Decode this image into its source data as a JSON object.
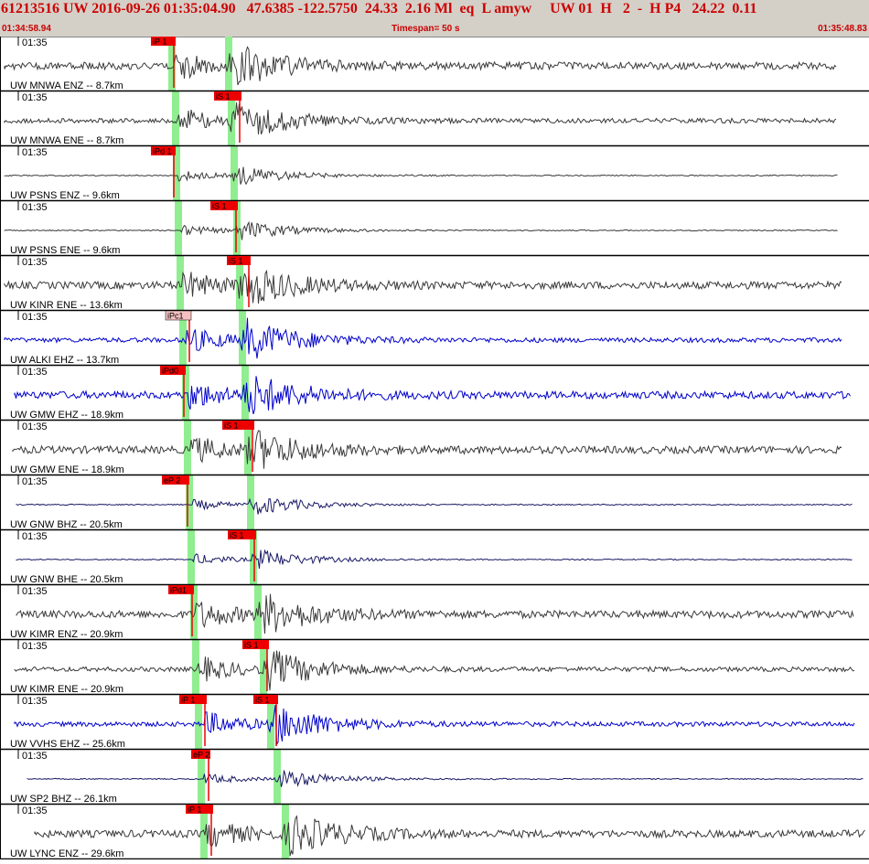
{
  "header": {
    "title": "61213516 UW 2016-09-26 01:35:04.90   47.6385 -122.5750  24.33  2.16 Ml  eq  L amyw     UW 01  H   2  -  H P4   24.22  0.11",
    "start_time": "01:34:58.94",
    "timespan": "Timespan=  50 s",
    "end_time": "01:35:48.83"
  },
  "colors": {
    "background": "#ffffff",
    "header_bg": "#d4d0c8",
    "header_text": "#cc0000",
    "trace_gray": "#3a3a3a",
    "trace_blue": "#0000cc",
    "trace_navy": "#1a1a66",
    "pick_flag": "#ee0000",
    "pick_flag_alt": "#f4c0c0",
    "phase_band": "#90ee90"
  },
  "panels": [
    {
      "station": "UW MNWA ENZ -- 8.7km",
      "time": "01:35",
      "pick": "iP 1",
      "color": "gray",
      "amp": "high",
      "alt": false
    },
    {
      "station": "UW MNWA ENE -- 8.7km",
      "time": "01:35",
      "pick": "iS 1",
      "color": "gray",
      "amp": "med",
      "alt": false
    },
    {
      "station": "UW PSNS ENZ -- 9.6km",
      "time": "01:35",
      "pick": "iPd 1",
      "color": "gray",
      "amp": "low",
      "alt": false
    },
    {
      "station": "UW PSNS ENE -- 9.6km",
      "time": "01:35",
      "pick": "iS 1",
      "color": "gray",
      "amp": "low",
      "alt": false
    },
    {
      "station": "UW KINR ENE -- 13.6km",
      "time": "01:35",
      "pick": "iS 1",
      "color": "gray",
      "amp": "high",
      "alt": false
    },
    {
      "station": "UW ALKI EHZ -- 13.7km",
      "time": "01:35",
      "pick": "iPc1",
      "color": "blue",
      "amp": "med",
      "alt": true
    },
    {
      "station": "UW GMW EHZ -- 18.9km",
      "time": "01:35",
      "pick": "iPd0",
      "color": "blue",
      "amp": "high",
      "alt": false
    },
    {
      "station": "UW GMW ENE -- 18.9km",
      "time": "01:35",
      "pick": "iS 1",
      "color": "gray",
      "amp": "high",
      "alt": false
    },
    {
      "station": "UW GNW BHZ -- 20.5km",
      "time": "01:35",
      "pick": "eP 2",
      "color": "navy",
      "amp": "low",
      "alt": false
    },
    {
      "station": "UW GNW BHE -- 20.5km",
      "time": "01:35",
      "pick": "iS 1",
      "color": "navy",
      "amp": "low",
      "alt": false
    },
    {
      "station": "UW KIMR ENZ -- 20.9km",
      "time": "01:35",
      "pick": "iPd1",
      "color": "gray",
      "amp": "high",
      "alt": false
    },
    {
      "station": "UW KIMR ENE -- 20.9km",
      "time": "01:35",
      "pick": "iS 1",
      "color": "gray",
      "amp": "med",
      "alt": false
    },
    {
      "station": "UW VVHS EHZ -- 25.6km",
      "time": "01:35",
      "pick": "iP 1",
      "pick2": "iS 1",
      "color": "blue",
      "amp": "med",
      "alt": false
    },
    {
      "station": "UW SP2 BHZ -- 26.1km",
      "time": "01:35",
      "pick": "eP 2",
      "color": "navy",
      "amp": "low",
      "alt": false
    },
    {
      "station": "UW LYNC ENZ -- 29.6km",
      "time": "01:35",
      "pick": "iP 1",
      "color": "gray",
      "amp": "high",
      "alt": false
    }
  ]
}
